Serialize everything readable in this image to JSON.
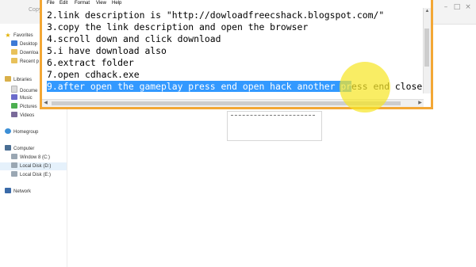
{
  "explorer": {
    "caption": "Copy",
    "nav": {
      "favorites": "Favorites",
      "desktop": "Desktop",
      "downloads": "Downloa",
      "recent": "Recent p",
      "libraries": "Libraries",
      "documents": "Docume",
      "music": "Music",
      "pictures": "Pictures",
      "videos": "Videos",
      "homegroup": "Homegroup",
      "computer": "Computer",
      "drive_c": "Window 8 (C:)",
      "drive_d": "Local Disk (D:)",
      "drive_e": "Local Disk (E:)",
      "network": "Network"
    }
  },
  "notepad": {
    "menu": {
      "file": "File",
      "edit": "Edit",
      "format": "Format",
      "view": "View",
      "help": "Help"
    },
    "lines": {
      "l2": "2.link description is \"http://dowloadfreecshack.blogspot.com/\"",
      "l3": "3.copy the link description and open the browser",
      "l4": "4.scroll down and click download",
      "l5": "5.i have download also",
      "l6": "6.extract folder",
      "l7": "7.open cdhack.exe",
      "l9_selected": "9.after open the gameplay press end open hack another pr",
      "l9_rest": "ess end close"
    }
  },
  "colors": {
    "selection": "#3399ff",
    "window_border": "#f3a735",
    "cursor_highlight": "#f7e628"
  }
}
